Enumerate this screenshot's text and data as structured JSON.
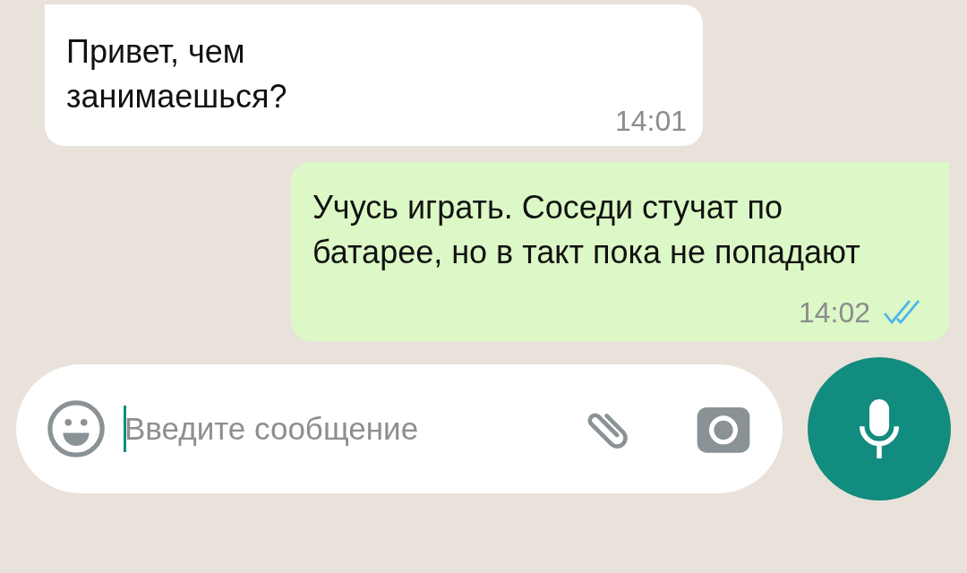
{
  "messages": [
    {
      "kind": "incoming",
      "text": "Привет, чем занимаешься?",
      "time": "14:01"
    },
    {
      "kind": "outgoing",
      "text": "Учусь играть. Соседи стучат по батарее, но в такт пока не попадают",
      "time": "14:02",
      "read": true
    }
  ],
  "composer": {
    "placeholder": "Введите сообщение"
  }
}
